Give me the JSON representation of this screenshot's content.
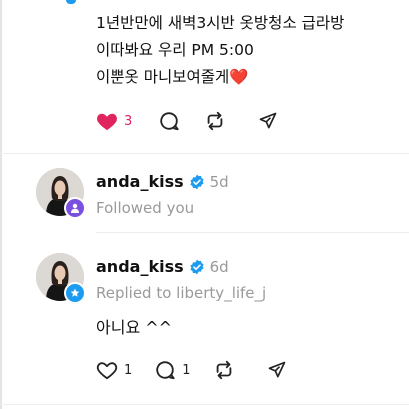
{
  "post": {
    "lines": [
      "1년반만에 새벽3시반 옷방청소 급라방",
      "이따봐요 우리 PM 5:00",
      "이뿐옷 마니보여줄게"
    ],
    "heart_emoji": "❤️",
    "like_count": "3"
  },
  "notifications": [
    {
      "username": "anda_kiss",
      "time": "5d",
      "subtitle": "Followed you",
      "badge_color": "#7b4fe0"
    },
    {
      "username": "anda_kiss",
      "time": "6d",
      "subtitle": "Replied to liberty_life_j",
      "badge_color": "#1d9bf0",
      "reply_text": "아니요 ^^",
      "like_count": "1",
      "reply_count": "1"
    }
  ],
  "colors": {
    "like_active": "#e0245e",
    "verified": "#1d9bf0",
    "muted_text": "#9a9a9a"
  }
}
